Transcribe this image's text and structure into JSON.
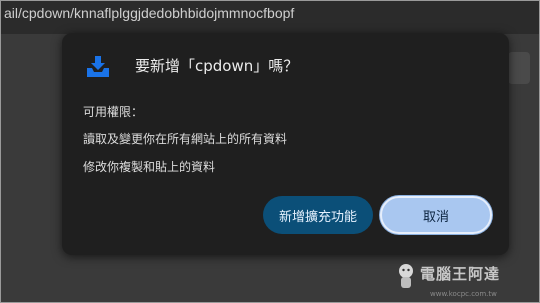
{
  "browser": {
    "url": "ail/cpdown/knnaflplggjdedobhbidojmmnocfbopf"
  },
  "dialog": {
    "icon": "download-tray-icon",
    "title": "要新增「cpdown」嗎？",
    "permissions_label": "可用權限：",
    "permissions": [
      "讀取及變更你在所有網站上的所有資料",
      "修改你複製和貼上的資料"
    ],
    "buttons": {
      "add": "新增擴充功能",
      "cancel": "取消"
    },
    "colors": {
      "add_button": "#0b4f78",
      "cancel_button": "#a9c7f0",
      "icon_blue": "#1a73e8"
    }
  },
  "watermark": {
    "text": "電腦王阿達",
    "url": "www.kocpc.com.tw"
  }
}
